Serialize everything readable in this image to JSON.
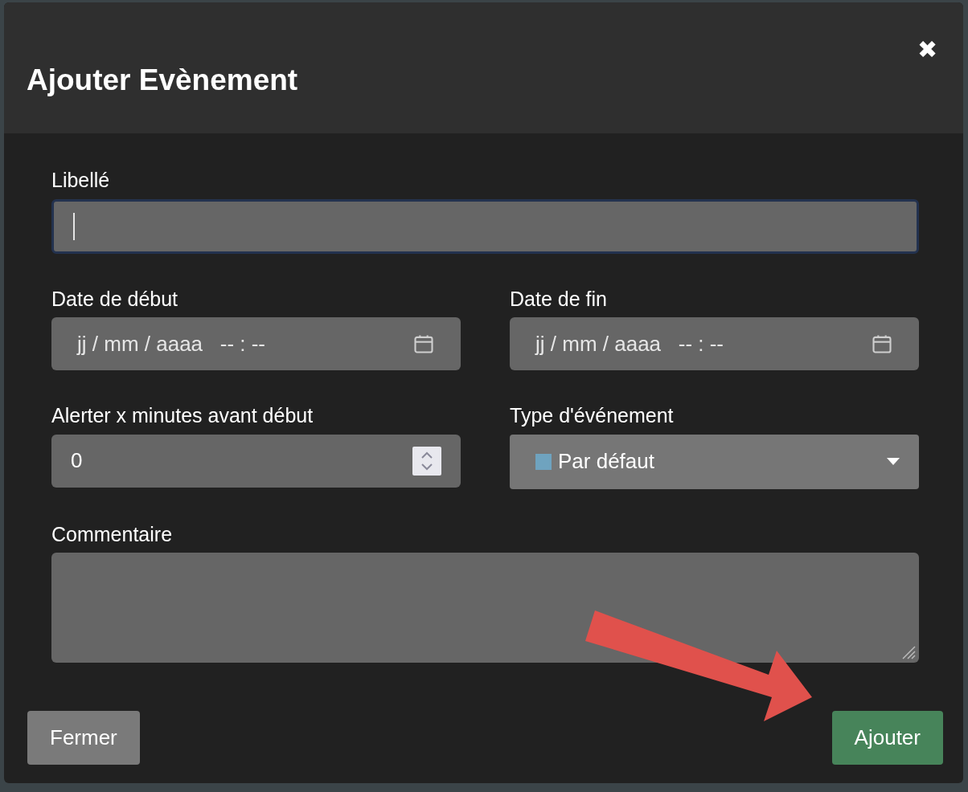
{
  "dialog": {
    "title": "Ajouter Evènement",
    "close": "✖"
  },
  "fields": [
    {
      "kind": "text",
      "label": "Libellé",
      "focused": true
    },
    {
      "kind": "datetime",
      "label": "Date de début",
      "placeholder": "jj / mm / aaaa   -- : --"
    },
    {
      "kind": "datetime",
      "label": "Date de fin",
      "placeholder": "jj / mm / aaaa   -- : --"
    },
    {
      "kind": "number",
      "label": "Alerter x minutes avant début",
      "value": "0"
    },
    {
      "kind": "select",
      "label": "Type d'événement",
      "value": "Par défaut",
      "color": "#6fa3bf"
    },
    {
      "kind": "textarea",
      "label": "Commentaire"
    }
  ],
  "buttons": [
    {
      "label": "Fermer",
      "kind": "secondary"
    },
    {
      "label": "Ajouter",
      "kind": "primary"
    }
  ]
}
